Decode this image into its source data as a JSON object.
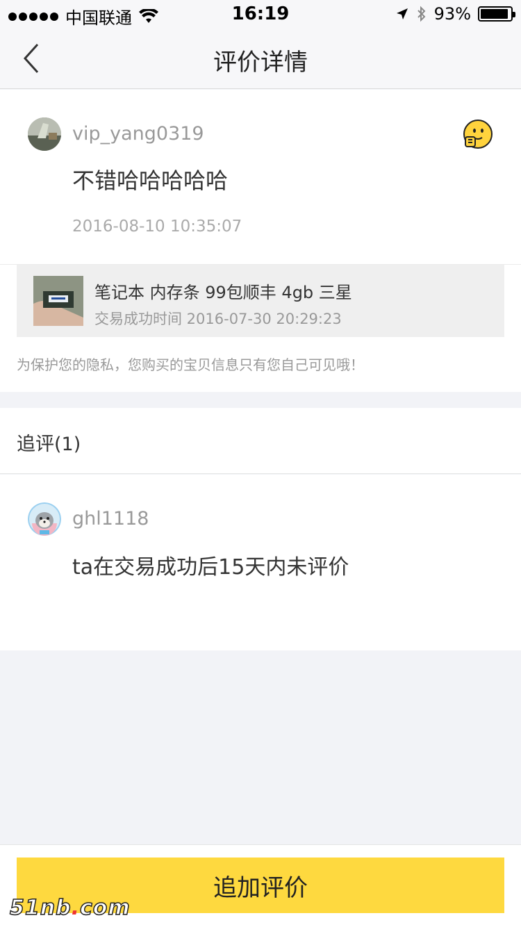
{
  "status_bar": {
    "carrier": "中国联通",
    "time": "16:19",
    "battery_percent": "93%",
    "battery_level": 0.93,
    "icons": [
      "signal-icon",
      "wifi-icon",
      "location-arrow-icon",
      "bluetooth-icon",
      "battery-icon"
    ]
  },
  "nav": {
    "title": "评价详情",
    "back_icon": "chevron-left-icon"
  },
  "review": {
    "username": "vip_yang0319",
    "text": "不错哈哈哈哈哈",
    "time": "2016-08-10 10:35:07",
    "emoji_icon": "thumbs-up-smiley-icon"
  },
  "product": {
    "name": "笔记本 内存条 99包顺丰 4gb 三星",
    "deal_time": "交易成功时间 2016-07-30 20:29:23"
  },
  "privacy_note": "为保护您的隐私，您购买的宝贝信息只有您自己可见哦！",
  "followup": {
    "title": "追评(1)",
    "username": "ghl1118",
    "text": "ta在交易成功后15天内未评价"
  },
  "bottom": {
    "button_label": "追加评价"
  },
  "watermark": {
    "text_a": "51nb",
    "dot": ".",
    "text_b": "com"
  },
  "colors": {
    "accent": "#fed93f",
    "page_bg": "#f2f3f7",
    "secondary_text": "#999999"
  }
}
